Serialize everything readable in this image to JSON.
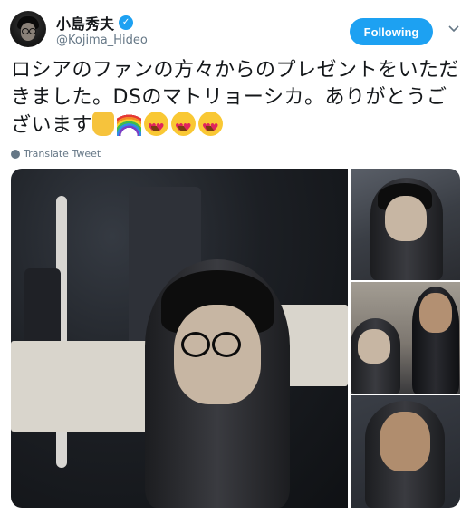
{
  "author": {
    "name": "小島秀夫",
    "handle": "@Kojima_Hideo",
    "verified_icon": "verified-badge-icon"
  },
  "follow_button": {
    "label": "Following"
  },
  "tweet": {
    "text": "ロシアのファンの方々からのプレゼントをいただきました。DSのマトリョーシカ。ありがとうございます",
    "emojis": [
      "thumbs-up",
      "rainbow",
      "heart-eyes",
      "heart-eyes",
      "heart-eyes"
    ]
  },
  "translate_label": "Translate Tweet",
  "colors": {
    "accent": "#1da1f2",
    "text": "#14171a",
    "secondary": "#657786"
  }
}
